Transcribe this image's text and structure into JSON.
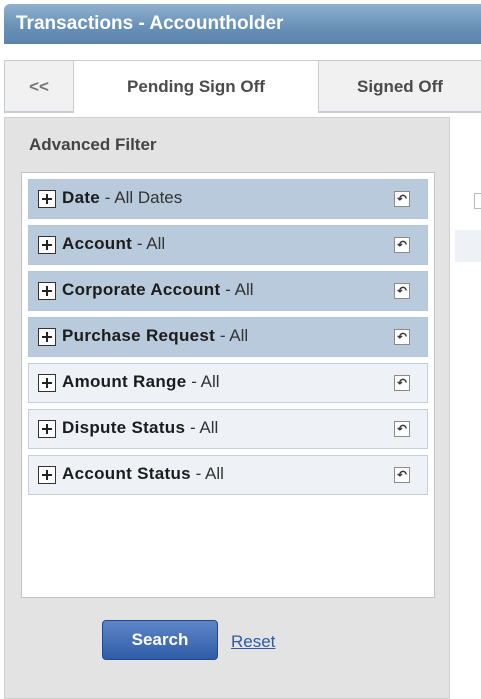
{
  "window": {
    "title": "Transactions - Accountholder"
  },
  "tabs": [
    {
      "label": "<<"
    },
    {
      "label": "Pending Sign Off"
    },
    {
      "label": "Signed Off"
    }
  ],
  "filter": {
    "title": "Advanced Filter",
    "items": [
      {
        "name": "Date",
        "value": " - All Dates"
      },
      {
        "name": "Account",
        "value": " - All"
      },
      {
        "name": "Corporate Account",
        "value": " - All"
      },
      {
        "name": "Purchase Request",
        "value": " - All"
      },
      {
        "name": "Amount Range",
        "value": " - All"
      },
      {
        "name": "Dispute Status",
        "value": " - All"
      },
      {
        "name": "Account Status",
        "value": " - All"
      }
    ],
    "search_label": "Search",
    "reset_label": "Reset"
  },
  "icons": {
    "expand": "plus-box-icon",
    "row_reset": "undo-icon"
  }
}
